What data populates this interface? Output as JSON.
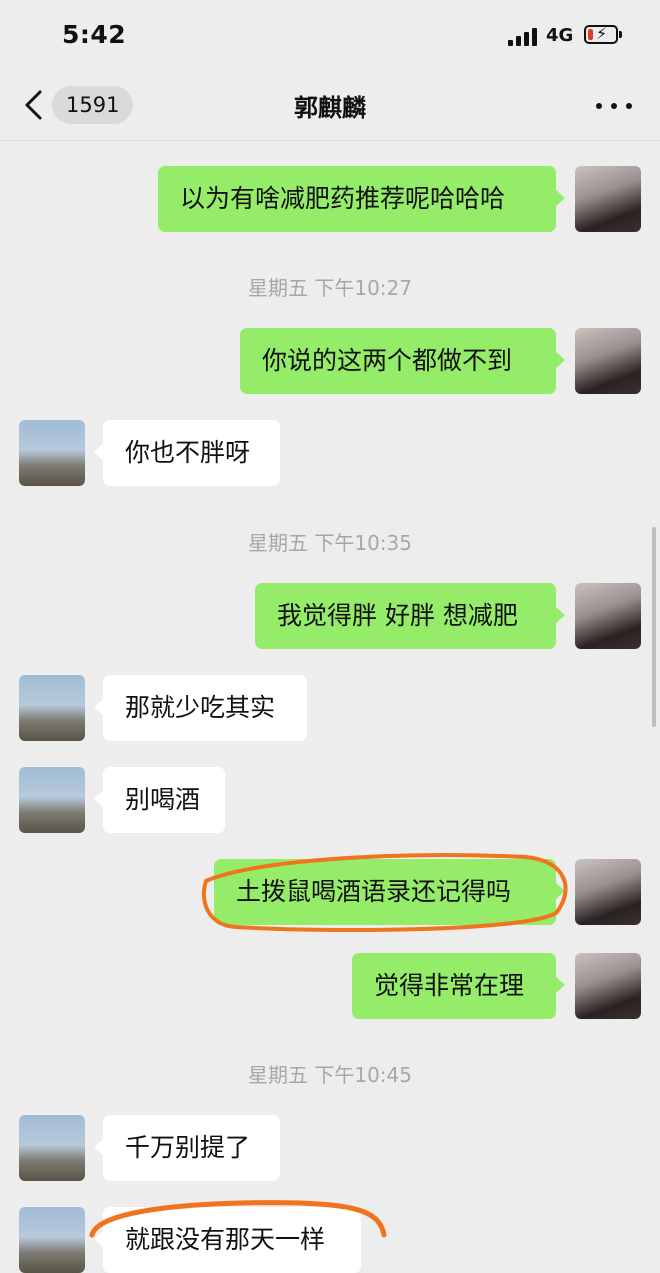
{
  "status_bar": {
    "time": "5:42",
    "network": "4G",
    "battery_level": 0.2,
    "battery_color": "#e03a2d",
    "bolt": "⚡"
  },
  "nav": {
    "back_icon": "chevron-left-icon",
    "unread_count": "1591",
    "title": "郭麒麟",
    "more_icon": "ellipsis-icon"
  },
  "colors": {
    "self_bubble": "#95ec69",
    "other_bubble": "#ffffff",
    "background": "#ededed",
    "annotation": "#f0741e"
  },
  "messages": [
    {
      "type": "msg",
      "from": "self",
      "text": "以为有啥减肥药推荐呢哈哈哈"
    },
    {
      "type": "time",
      "text": "星期五 下午10:27"
    },
    {
      "type": "msg",
      "from": "self",
      "text": "你说的这两个都做不到"
    },
    {
      "type": "msg",
      "from": "other",
      "text": "你也不胖呀"
    },
    {
      "type": "time",
      "text": "星期五 下午10:35"
    },
    {
      "type": "msg",
      "from": "self",
      "text": "我觉得胖 好胖 想减肥"
    },
    {
      "type": "msg",
      "from": "other",
      "text": "那就少吃其实"
    },
    {
      "type": "msg",
      "from": "other",
      "text": "别喝酒"
    },
    {
      "type": "msg",
      "from": "self",
      "text": "土拨鼠喝酒语录还记得吗",
      "highlighted": true
    },
    {
      "type": "msg",
      "from": "self",
      "text": "觉得非常在理"
    },
    {
      "type": "time",
      "text": "星期五 下午10:45"
    },
    {
      "type": "msg",
      "from": "other",
      "text": "千万别提了"
    },
    {
      "type": "msg",
      "from": "other",
      "text": "就跟没有那天一样",
      "highlighted": true
    }
  ]
}
